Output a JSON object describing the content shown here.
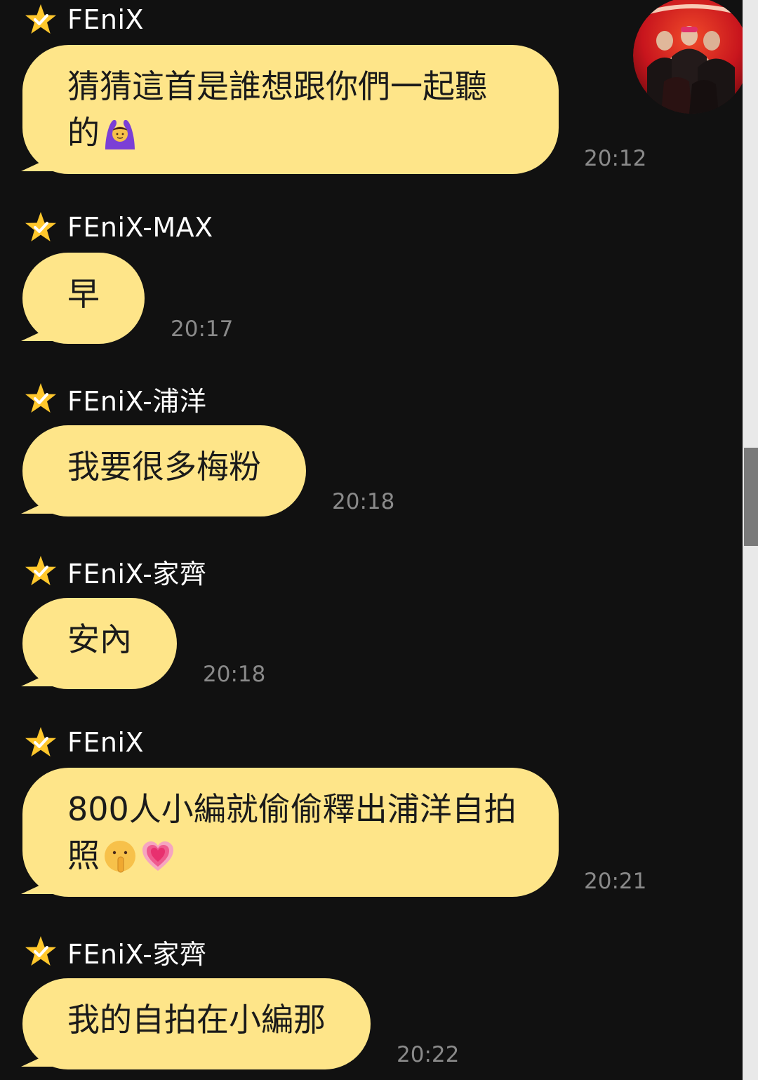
{
  "app": {
    "background": "#111111",
    "bubble_color": "#fee589",
    "star_color": "#ffc72c"
  },
  "channel_avatar": {
    "icon": "group-avatar-icon"
  },
  "messages": [
    {
      "sender": "FEniX",
      "text": "猜猜這首是誰想跟你們一起聽的",
      "emoji": [
        "raising-hands-woman-emoji"
      ],
      "time": "20:12"
    },
    {
      "sender": "FEniX-MAX",
      "text": "早",
      "emoji": [],
      "time": "20:17"
    },
    {
      "sender": "FEniX-浦洋",
      "text": "我要很多梅粉",
      "emoji": [],
      "time": "20:18"
    },
    {
      "sender": "FEniX-家齊",
      "text": "安內",
      "emoji": [],
      "time": "20:18"
    },
    {
      "sender": "FEniX",
      "text": "800人小編就偷偷釋出浦洋自拍照",
      "emoji": [
        "shushing-face-emoji",
        "growing-heart-emoji"
      ],
      "time": "20:21"
    },
    {
      "sender": "FEniX-家齊",
      "text": "我的自拍在小編那",
      "emoji": [],
      "time": "20:22"
    }
  ]
}
